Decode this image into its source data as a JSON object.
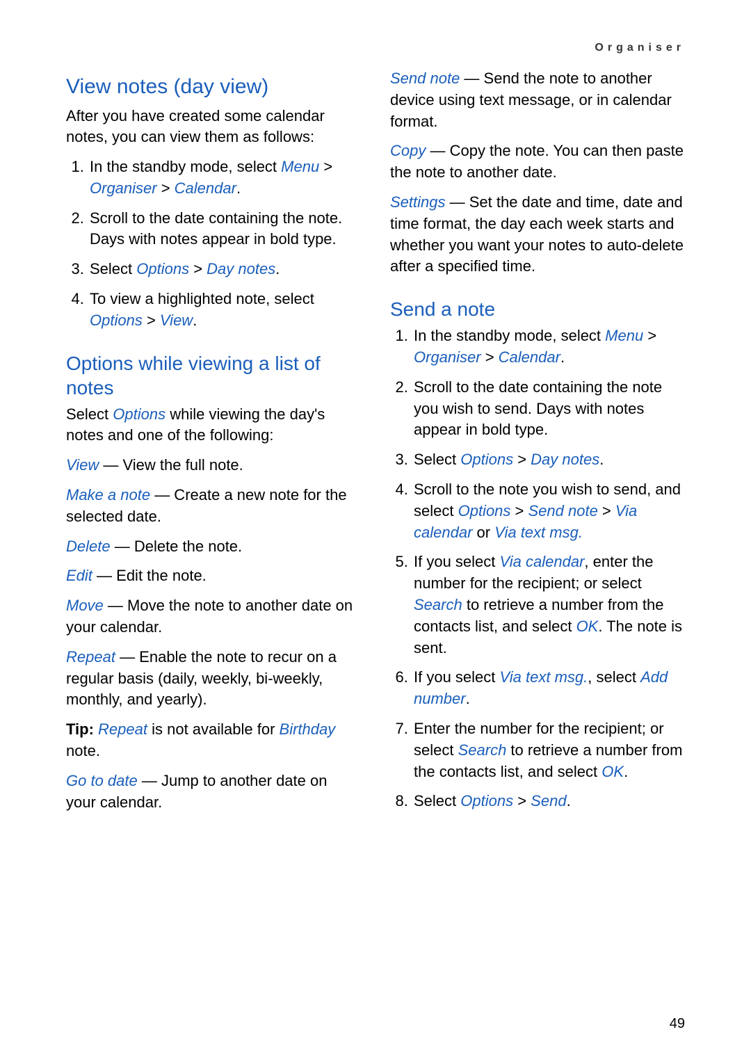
{
  "running_head": "Organiser",
  "page_number": "49",
  "left": {
    "h_view_notes": "View notes (day view)",
    "p_after_created": "After you have created some calendar notes, you can view them as follows:",
    "ol1_1_a": "In the standby mode, select ",
    "ol1_1_menu": "Menu",
    "ol1_1_b": " > ",
    "ol1_1_org": "Organiser",
    "ol1_1_c": " > ",
    "ol1_1_cal": "Calendar",
    "ol1_1_d": ".",
    "ol1_2": "Scroll to the date containing the note. Days with notes appear in bold type.",
    "ol1_3_a": "Select ",
    "ol1_3_opt": "Options",
    "ol1_3_b": " > ",
    "ol1_3_day": "Day notes",
    "ol1_3_c": ".",
    "ol1_4_a": "To view a highlighted note, select ",
    "ol1_4_opt": "Options",
    "ol1_4_b": " > ",
    "ol1_4_view": "View",
    "ol1_4_c": ".",
    "h_options_list": "Options while viewing a list of notes",
    "p_select_a": "Select ",
    "p_select_opt": "Options",
    "p_select_b": " while viewing the day's notes and one of the following:",
    "view_k": "View",
    "view_v": " — View the full note.",
    "make_k": "Make a note",
    "make_v": " — Create a new note for the selected date.",
    "delete_k": "Delete",
    "delete_v": " — Delete the note.",
    "edit_k": "Edit",
    "edit_v": " — Edit the note.",
    "move_k": "Move",
    "move_v": " — Move the note to another date on your calendar.",
    "repeat_k": "Repeat",
    "repeat_v": " — Enable the note to recur on a regular basis (daily, weekly, bi-weekly, monthly, and yearly).",
    "tip_a": "Tip: ",
    "tip_repeat": "Repeat",
    "tip_b": " is not available for ",
    "tip_birthday": "Birthday",
    "tip_c": " note.",
    "goto_k": "Go to date",
    "goto_v": " — Jump to another date on your calendar."
  },
  "right": {
    "sendnote_k": "Send note",
    "sendnote_v": " — Send the note to another device using text message, or in calendar format.",
    "copy_k": "Copy",
    "copy_v": " — Copy the note. You can then paste the note to another date.",
    "settings_k": "Settings",
    "settings_v": " — Set the date and time, date and time format, the day each week starts and whether you want your notes to auto-delete after a specified time.",
    "h_send_a_note": "Send a note",
    "ol2_1_a": "In the standby mode, select ",
    "ol2_1_menu": "Menu",
    "ol2_1_b": " > ",
    "ol2_1_org": "Organiser",
    "ol2_1_c": " > ",
    "ol2_1_cal": "Calendar",
    "ol2_1_d": ".",
    "ol2_2": "Scroll to the date containing the note you wish to send. Days with notes appear in bold type.",
    "ol2_3_a": "Select ",
    "ol2_3_opt": "Options",
    "ol2_3_b": " > ",
    "ol2_3_day": "Day notes",
    "ol2_3_c": ".",
    "ol2_4_a": "Scroll to the note you wish to send, and select ",
    "ol2_4_opt": "Options",
    "ol2_4_b": " > ",
    "ol2_4_send": "Send note",
    "ol2_4_c": " > ",
    "ol2_4_viacal": "Via calendar",
    "ol2_4_d": " or ",
    "ol2_4_viatxt": "Via text msg.",
    "ol2_5_a": "If you select ",
    "ol2_5_viacal": "Via calendar",
    "ol2_5_b": ", enter the number for the recipient; or select ",
    "ol2_5_search": "Search",
    "ol2_5_c": " to retrieve a number from the contacts list, and select ",
    "ol2_5_ok": "OK",
    "ol2_5_d": ". The note is sent.",
    "ol2_6_a": "If you select ",
    "ol2_6_viatxt": "Via text msg.",
    "ol2_6_b": ", select ",
    "ol2_6_add": "Add number",
    "ol2_6_c": ".",
    "ol2_7_a": "Enter the number for the recipient; or select ",
    "ol2_7_search": "Search",
    "ol2_7_b": " to retrieve a number from the contacts list, and select ",
    "ol2_7_ok": "OK",
    "ol2_7_c": ".",
    "ol2_8_a": "Select ",
    "ol2_8_opt": "Options",
    "ol2_8_b": " > ",
    "ol2_8_send": "Send",
    "ol2_8_c": "."
  }
}
